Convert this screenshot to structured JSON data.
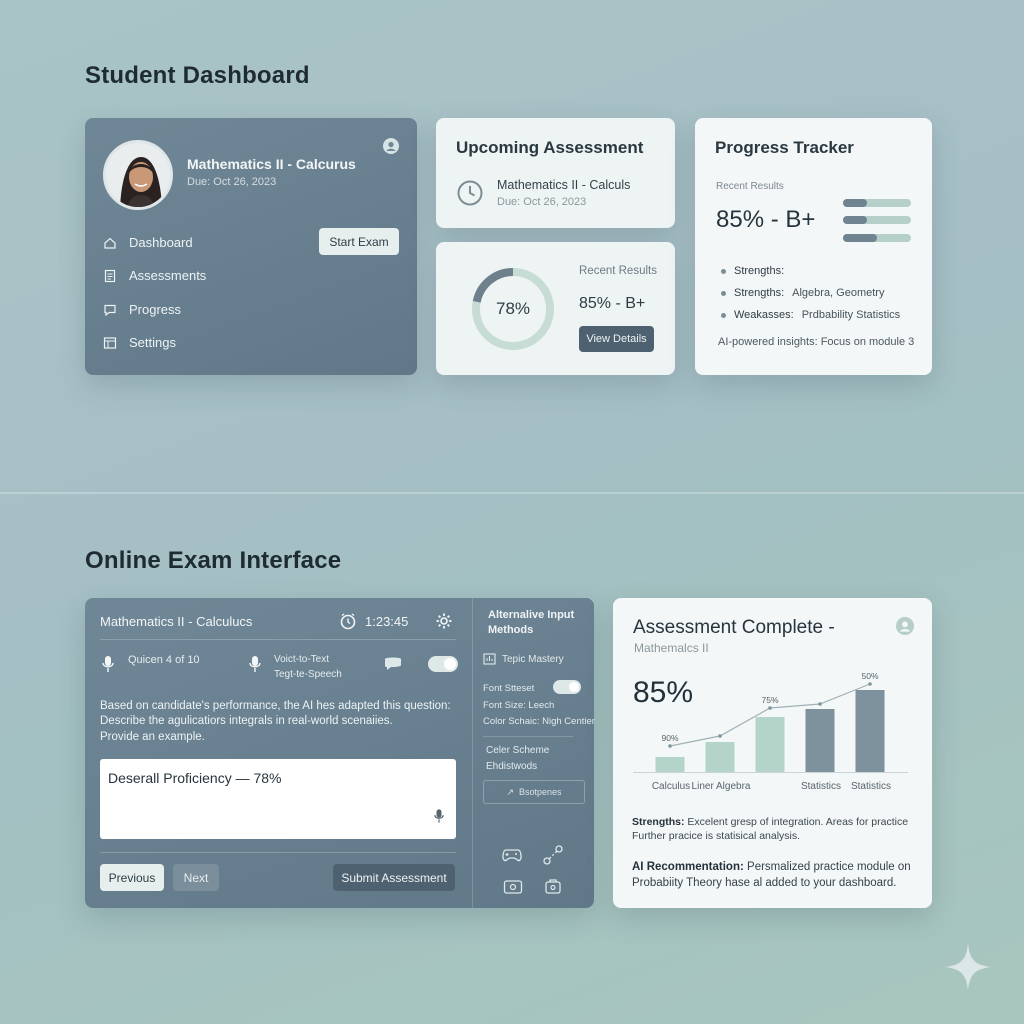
{
  "dashboard": {
    "title": "Student Dashboard",
    "profile": {
      "course": "Mathematics II - Calcurus",
      "due": "Due: Oct 26, 2023",
      "start_exam": "Start Exam",
      "nav": [
        {
          "label": "Dashboard",
          "icon": "home-icon"
        },
        {
          "label": "Assessments",
          "icon": "document-icon"
        },
        {
          "label": "Progress",
          "icon": "chat-icon"
        },
        {
          "label": "Settings",
          "icon": "settings-icon"
        }
      ]
    },
    "upcoming": {
      "title": "Upcoming Assessment",
      "course": "Mathematics II - Calculs",
      "due": "Due: Oct 26, 2023"
    },
    "results": {
      "donut_value": "78%",
      "donut_fraction": 0.78,
      "label": "Recent Results",
      "score": "85% - B+",
      "view_details": "View Details"
    },
    "progress": {
      "title": "Progress Tracker",
      "recent_label": "Recent Results",
      "score": "85% - B+",
      "bars": [
        0.35,
        0.35,
        0.5
      ],
      "items": [
        {
          "label": "Strengths:",
          "value": ""
        },
        {
          "label": "Strengths:",
          "value": "Algebra, Geometry"
        },
        {
          "label": "Weakasses:",
          "value": "Prdbability Statistics"
        }
      ],
      "insight": "AI-powered insights: Focus on module 3"
    }
  },
  "exam": {
    "title": "Online Exam Interface",
    "course": "Mathematics II - Calculucs",
    "timer": "1:23:45",
    "question_counter": "Quicen 4 of 10",
    "voice_to_text": "Voict-to-Text",
    "text_to_speech": "Tegt-te-Speech",
    "prompt_intro": "Based on candidate's performance, the AI hes adapted this question:",
    "prompt_body": "Describe the agulicatiors integrals in real-world scenaiies.",
    "prompt_end": "Provide an example.",
    "answer_text": "Deserall Proficiency — 78%",
    "previous": "Previous",
    "next": "Next",
    "submit": "Submit Assessment",
    "side": {
      "title": "Alternalive Input Methods",
      "topic_mastery": "Tepic Mastery",
      "font_streset": "Font Stteset",
      "font_size": "Font Size: Leech",
      "color_scheme_line": "Color Schaic: Nigh Centier",
      "color_scheme": "Celer Scheme",
      "ehdistwods": "Ehdistwods",
      "bsotpenes": "Bsotpenes"
    }
  },
  "complete": {
    "title": "Assessment Complete -",
    "subtitle": "Mathemalcs II",
    "score": "85%",
    "strengths_label": "Strengths:",
    "strengths_text": "Excelent gresp of integration. Areas for practice",
    "strengths_text2": "Further pracice is statisical analysis.",
    "ai_label": "AI Recommentation:",
    "ai_text": "Persmalized practice module on",
    "ai_text2": "Probabiity Theory hase al added to your dashboard."
  },
  "chart_data": {
    "type": "bar",
    "categories": [
      "Calculus",
      "Liner Algebra",
      "",
      "Statistics",
      "Statistics"
    ],
    "values": [
      15,
      30,
      55,
      63,
      82
    ],
    "line_values": [
      20,
      30,
      58,
      62,
      82
    ],
    "annotations": [
      {
        "index": 0,
        "text": "90%"
      },
      {
        "index": 2,
        "text": "75%"
      },
      {
        "index": 4,
        "text": "50%"
      }
    ],
    "ylim": [
      0,
      100
    ],
    "colors": {
      "light_bar": "#b5d4c9",
      "dark_bar": "#7e929d",
      "line": "#9fb2b8"
    }
  }
}
